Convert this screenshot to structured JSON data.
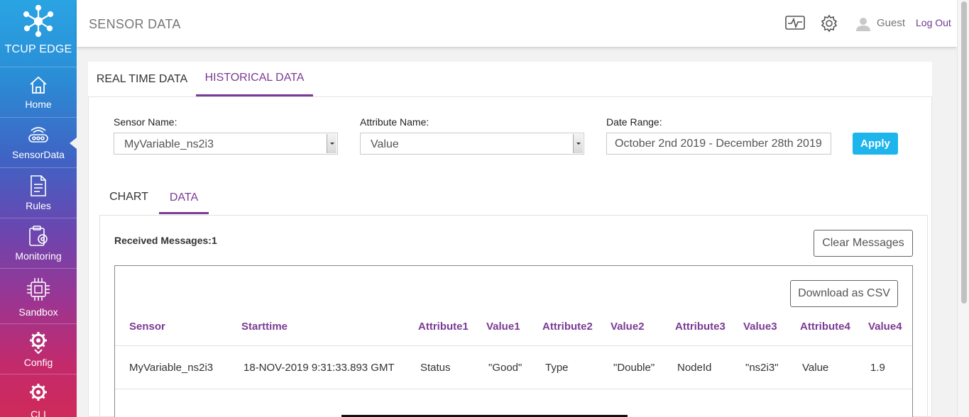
{
  "brand": {
    "name": "TCUP EDGE",
    "logo_icon": "network-hub-icon"
  },
  "sidebar": {
    "items": [
      {
        "label": "Home",
        "icon": "home-icon"
      },
      {
        "label": "SensorData",
        "icon": "sensor-icon",
        "active": true
      },
      {
        "label": "Rules",
        "icon": "document-icon"
      },
      {
        "label": "Monitoring",
        "icon": "clipboard-gear-icon"
      },
      {
        "label": "Sandbox",
        "icon": "chip-icon"
      },
      {
        "label": "Config",
        "icon": "gear-wrench-icon"
      },
      {
        "label": "CLI",
        "icon": "gear-wrench-icon"
      }
    ]
  },
  "header": {
    "title": "SENSOR DATA",
    "user": "Guest",
    "logout": "Log Out",
    "icons": [
      "activity-monitor-icon",
      "settings-gear-icon",
      "user-icon"
    ]
  },
  "main_tabs": [
    {
      "label": "REAL TIME DATA",
      "active": false
    },
    {
      "label": "HISTORICAL DATA",
      "active": true
    }
  ],
  "filters": {
    "sensor_label": "Sensor Name:",
    "sensor_value": "MyVariable_ns2i3",
    "attribute_label": "Attribute Name:",
    "attribute_value": "Value",
    "date_label": "Date Range:",
    "date_value": "October 2nd 2019 - December 28th 2019",
    "apply": "Apply"
  },
  "sub_tabs": [
    {
      "label": "CHART",
      "active": false
    },
    {
      "label": "DATA",
      "active": true
    }
  ],
  "data_panel": {
    "received": "Received Messages:1",
    "clear": "Clear Messages",
    "download": "Download as CSV"
  },
  "table": {
    "columns": [
      "Sensor",
      "Starttime",
      "Attribute1",
      "Value1",
      "Attribute2",
      "Value2",
      "Attribute3",
      "Value3",
      "Attribute4",
      "Value4"
    ],
    "rows": [
      [
        "MyVariable_ns2i3",
        "18-NOV-2019 9:31:33.893 GMT",
        "Status",
        "\"Good\"",
        "Type",
        "\"Double\"",
        "NodeId",
        "\"ns2i3\"",
        "Value",
        "1.9"
      ]
    ]
  },
  "colors": {
    "accent": "#7b3b94",
    "apply": "#1eb5ec"
  }
}
